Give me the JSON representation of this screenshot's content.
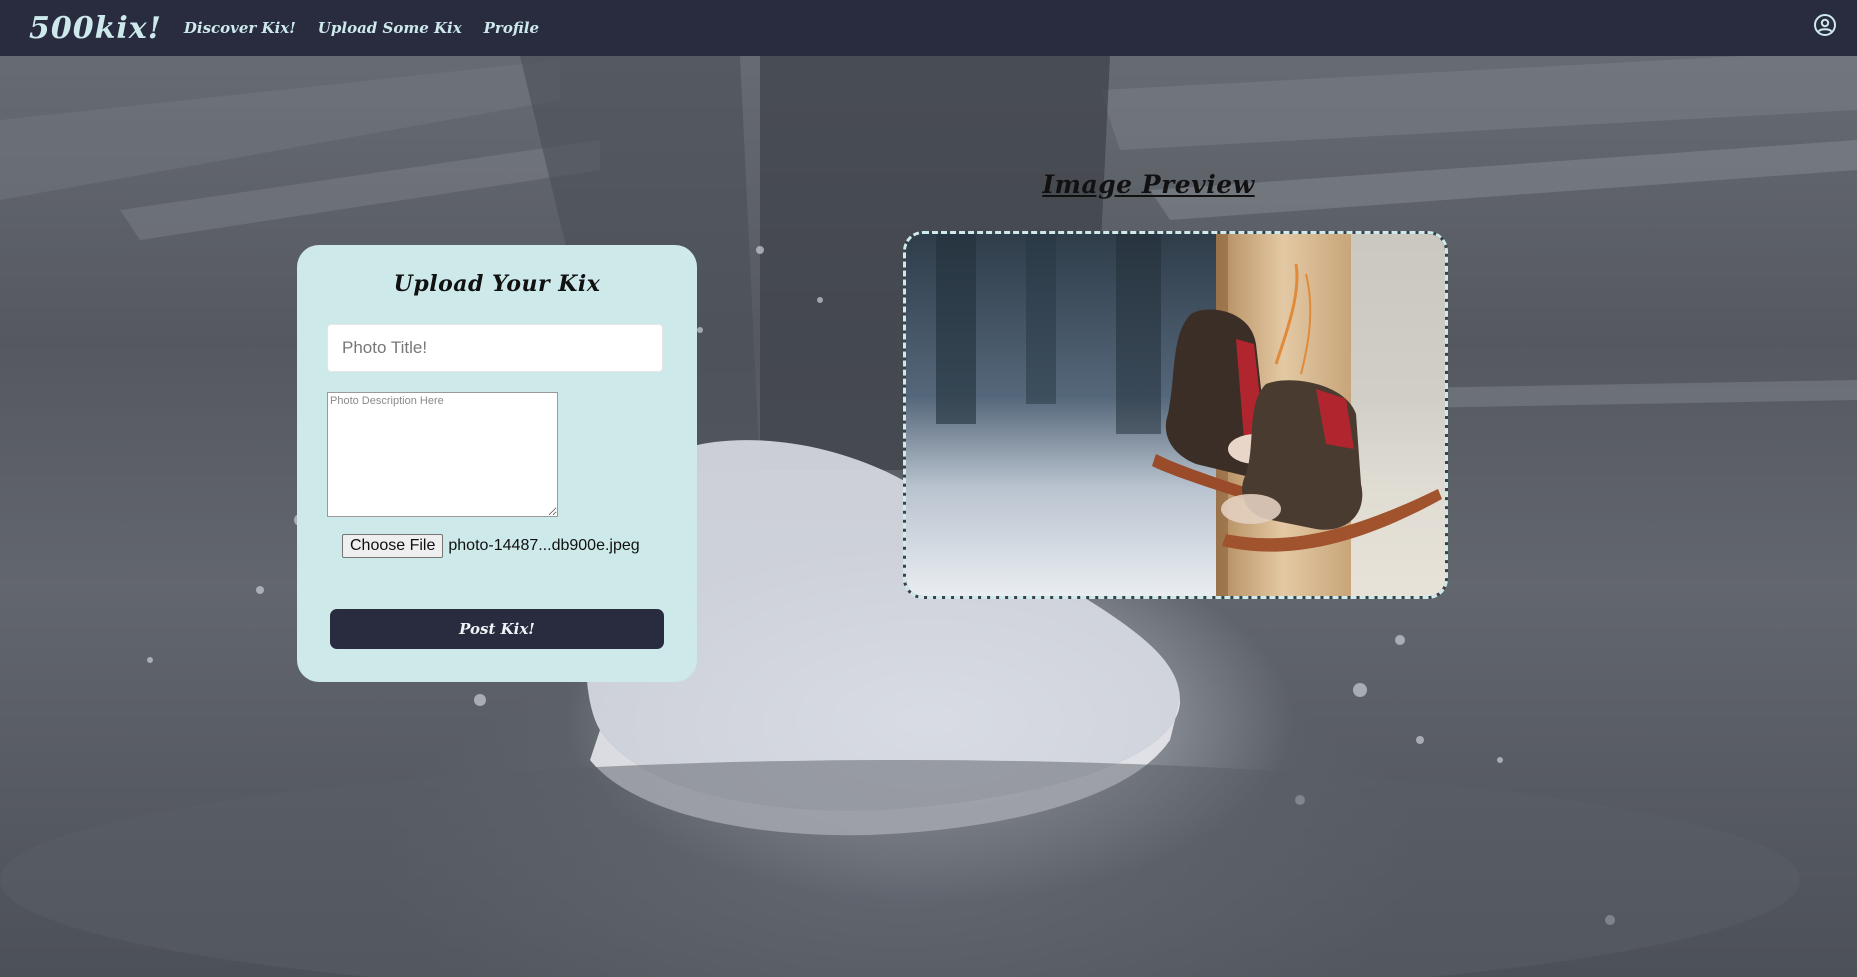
{
  "navbar": {
    "brand": "500kix!",
    "links": [
      "Discover Kix!",
      "Upload Some Kix",
      "Profile"
    ],
    "user_icon": "user-circle-icon"
  },
  "upload_form": {
    "title": "Upload Your Kix",
    "photo_title_placeholder": "Photo Title!",
    "photo_title_value": "",
    "description_placeholder": "Photo Description Here",
    "description_value": "",
    "file_button_label": "Choose File",
    "file_name": "photo-14487...db900e.jpeg",
    "submit_label": "Post Kix!"
  },
  "preview": {
    "heading": "Image Preview",
    "image_subject": "old-ice-skates-hanging-on-post"
  },
  "colors": {
    "navbar_bg": "#282c3e",
    "accent_light": "#cde9ea",
    "button_bg": "#282c3e"
  }
}
